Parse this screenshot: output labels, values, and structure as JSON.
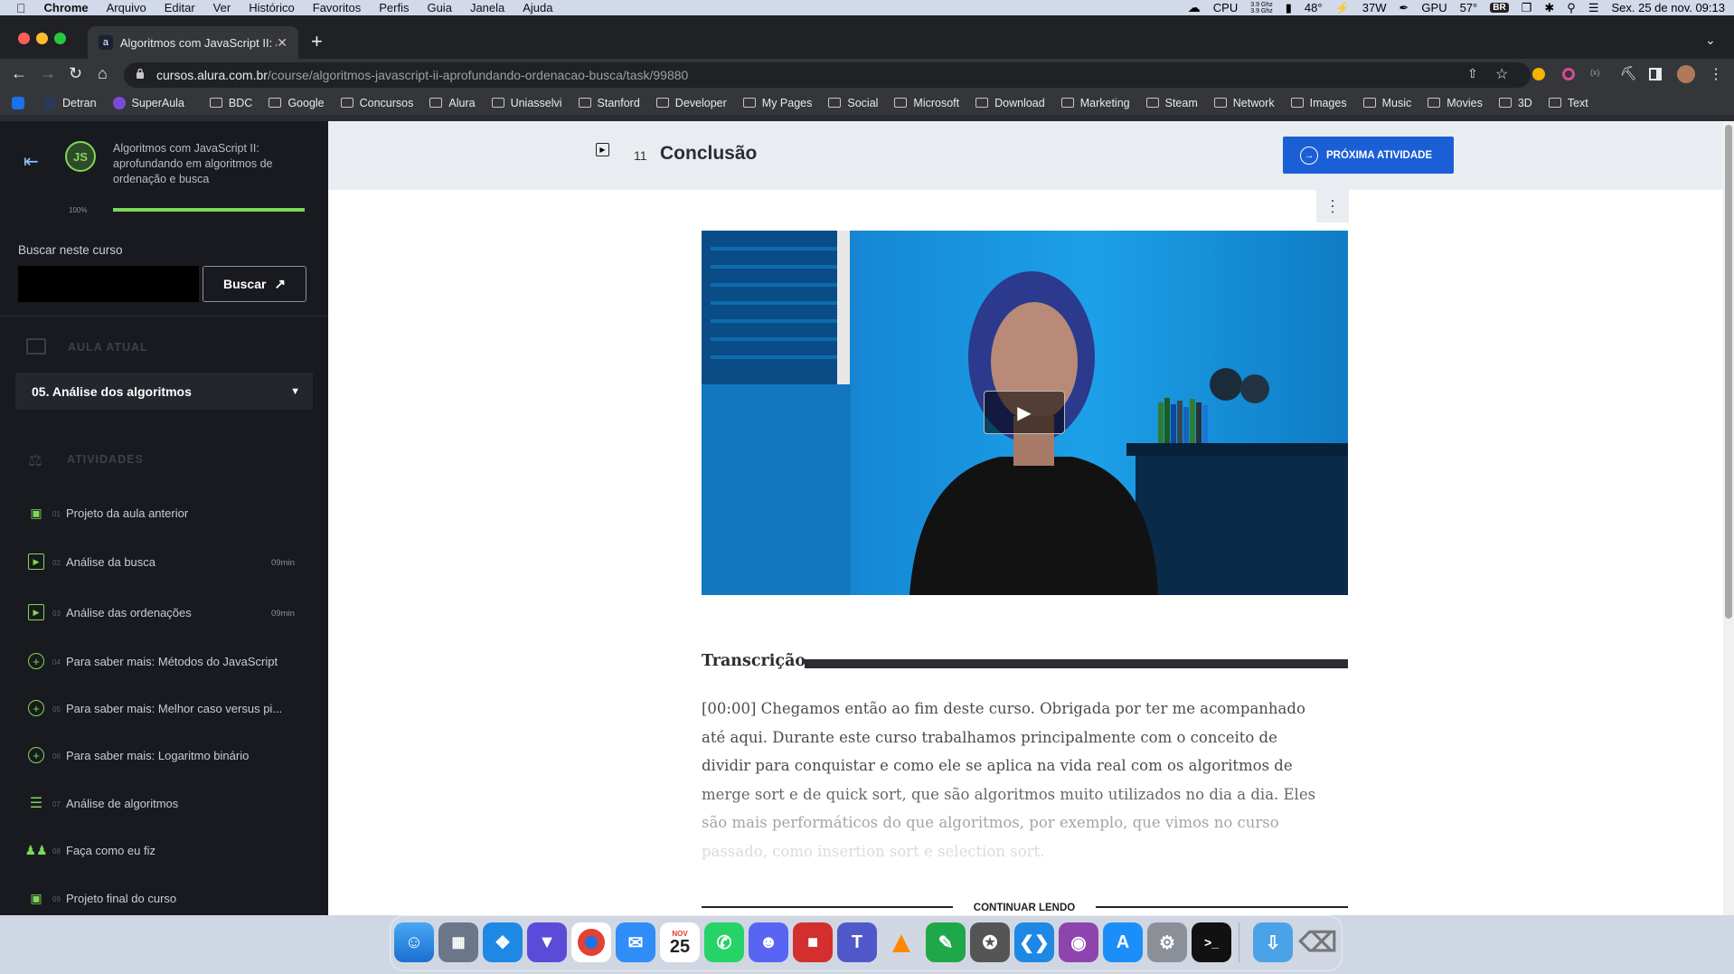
{
  "menubar": {
    "app": "Chrome",
    "items": [
      "Arquivo",
      "Editar",
      "Ver",
      "Histórico",
      "Favoritos",
      "Perfis",
      "Guia",
      "Janela",
      "Ajuda"
    ],
    "cpu_label": "CPU",
    "cpu_freq_top": "3.9 Ghz",
    "cpu_freq_bottom": "3.9 Ghz",
    "temp_cpu": "48°",
    "power": "37W",
    "gpu_label": "GPU",
    "temp_gpu": "57°",
    "input_lang": "BR",
    "datetime": "Sex. 25 de nov.  09:13"
  },
  "browser": {
    "tab_title": "Algoritmos com JavaScript II: a",
    "tab_favicon": "a",
    "url_host": "cursos.alura.com.br",
    "url_path": "/course/algoritmos-javascript-ii-aprofundando-ordenacao-busca/task/99880",
    "bookmarks": [
      "Detran",
      "SuperAula",
      "BDC",
      "Google",
      "Concursos",
      "Alura",
      "Uniasselvi",
      "Stanford",
      "Developer",
      "My Pages",
      "Social",
      "Microsoft",
      "Download",
      "Marketing",
      "Steam",
      "Network",
      "Images",
      "Music",
      "Movies",
      "3D",
      "Text"
    ]
  },
  "sidebar": {
    "course_badge": "JS",
    "course_title_1": "Algoritmos com JavaScript II:",
    "course_title_2": "aprofundando em algoritmos de",
    "course_title_3": "ordenação e busca",
    "progress_label": "100%",
    "progress": 1.0,
    "search_label": "Buscar neste curso",
    "search_value": "",
    "search_button": "Buscar",
    "section_current": "AULA ATUAL",
    "current_lesson": "05. Análise dos algoritmos",
    "section_activities": "ATIVIDADES",
    "activities": [
      {
        "num": "01",
        "label": "Projeto da aula anterior",
        "duration": "",
        "icon": "book-icon"
      },
      {
        "num": "02",
        "label": "Análise da busca",
        "duration": "09min",
        "icon": "video-icon"
      },
      {
        "num": "03",
        "label": "Análise das ordenações",
        "duration": "09min",
        "icon": "video-icon"
      },
      {
        "num": "04",
        "label": "Para saber mais: Métodos do JavaScript",
        "duration": "",
        "icon": "plus-icon"
      },
      {
        "num": "05",
        "label": "Para saber mais: Melhor caso versus pi...",
        "duration": "",
        "icon": "plus-icon"
      },
      {
        "num": "06",
        "label": "Para saber mais: Logaritmo binário",
        "duration": "",
        "icon": "plus-icon"
      },
      {
        "num": "07",
        "label": "Análise de algoritmos",
        "duration": "",
        "icon": "list-icon"
      },
      {
        "num": "08",
        "label": "Faça como eu fiz",
        "duration": "",
        "icon": "people-icon"
      },
      {
        "num": "09",
        "label": "Projeto final do curso",
        "duration": "",
        "icon": "book-icon"
      }
    ]
  },
  "main": {
    "task_number": "11",
    "task_title": "Conclusão",
    "next_button": "PRÓXIMA ATIVIDADE",
    "transcript_heading": "Transcrição",
    "transcript_lines": [
      "[00:00] Chegamos então ao fim deste curso. Obrigada por ter me acompanhado",
      "até aqui. Durante este curso trabalhamos principalmente com o conceito de",
      "dividir para conquistar e como ele se aplica na vida real com os algoritmos de",
      "merge sort e de quick sort, que são algoritmos muito utilizados no dia a dia. Eles",
      "são mais performáticos do que algoritmos, por exemplo, que vimos no curso",
      "passado, como insertion sort e selection sort."
    ],
    "continue_label": "CONTINUAR LENDO"
  },
  "dock": {
    "calendar_month": "NOV",
    "calendar_day": "25"
  },
  "colors": {
    "accent_green": "#7ed957",
    "primary_blue": "#1a5fd6",
    "sidebar_bg": "#181a1f"
  }
}
